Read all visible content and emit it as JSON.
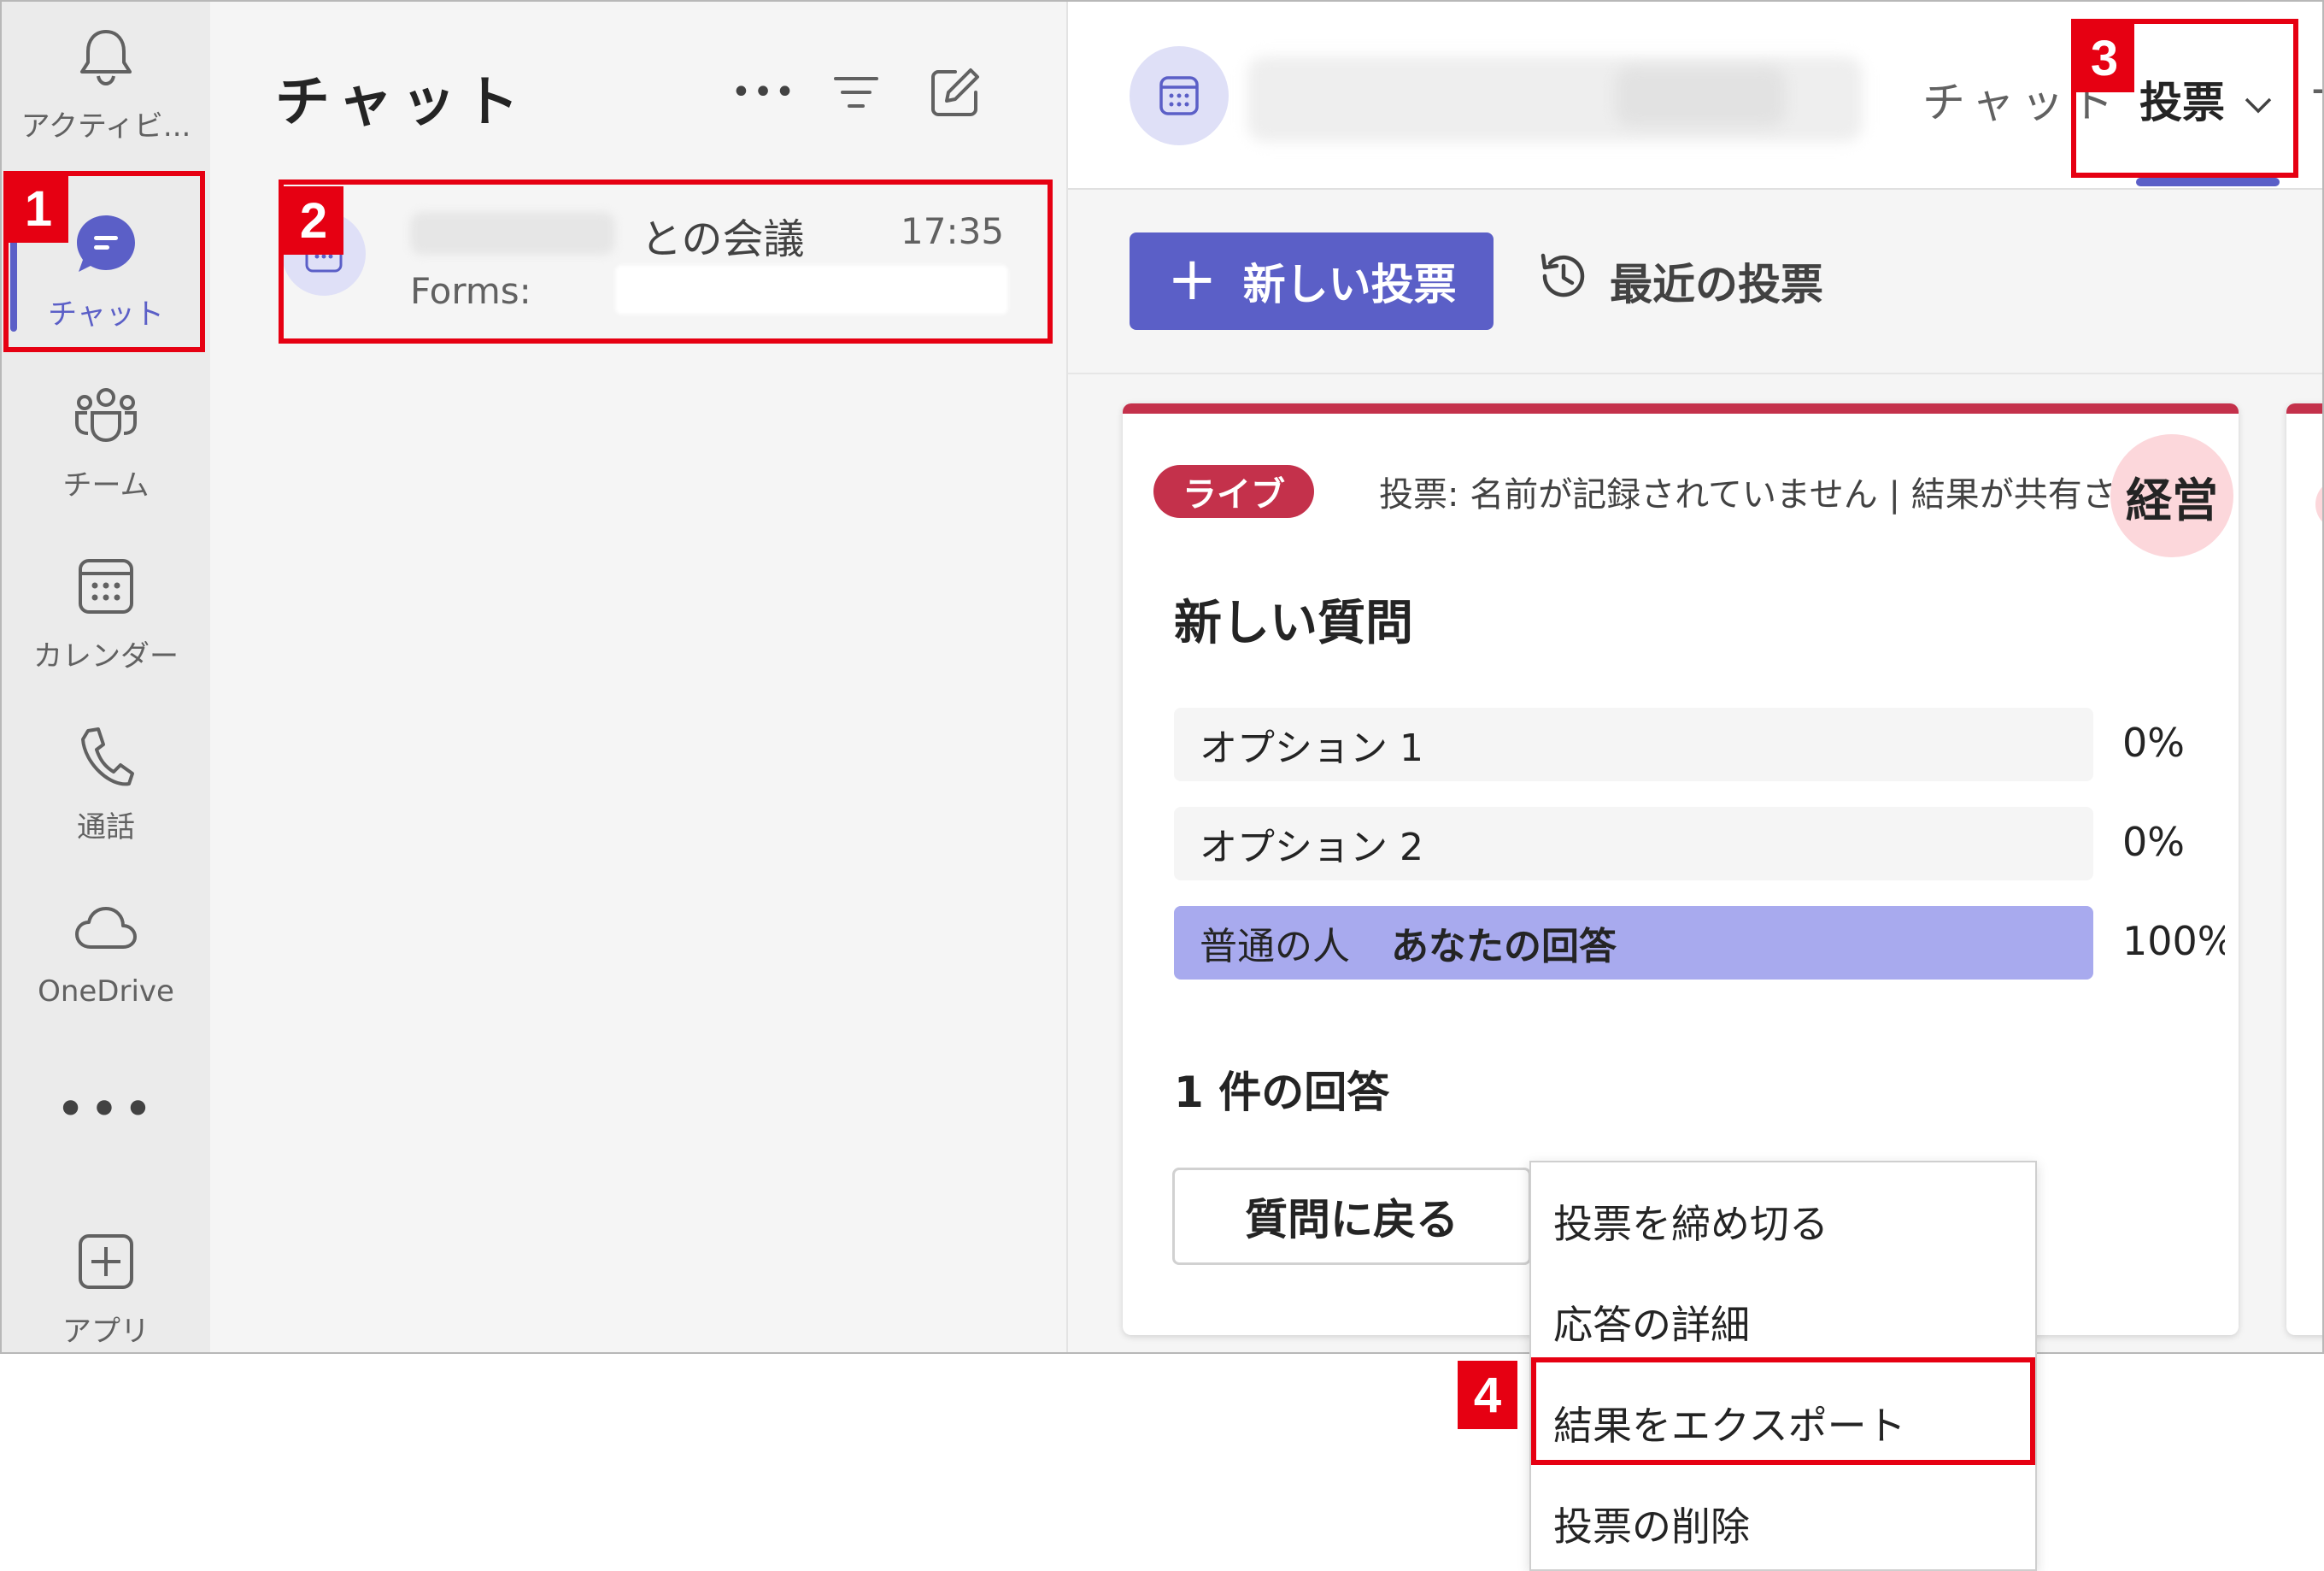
{
  "rail": {
    "items": [
      {
        "label": "アクティビ...",
        "icon": "bell-icon"
      },
      {
        "label": "チャット",
        "icon": "chat-icon"
      },
      {
        "label": "チーム",
        "icon": "teams-icon"
      },
      {
        "label": "カレンダー",
        "icon": "calendar-icon"
      },
      {
        "label": "通話",
        "icon": "phone-icon"
      },
      {
        "label": "OneDrive",
        "icon": "cloud-icon"
      },
      {
        "label": "アプリ",
        "icon": "add-app-icon"
      }
    ],
    "more_glyph": "•••"
  },
  "chatlist": {
    "title": "チャット",
    "more_glyph": "•••",
    "row": {
      "title": "との会議",
      "time": "17:35",
      "preview_prefix": "Forms:"
    }
  },
  "header": {
    "tabs": [
      {
        "label": "チャット"
      },
      {
        "label": "投票"
      }
    ],
    "plus_glyph": "+"
  },
  "toolbar": {
    "new_poll_label": "新しい投票",
    "plus_glyph": "+",
    "recent_label": "最近の投票"
  },
  "poll": {
    "status_badge": "ライブ",
    "meta": "投票: 名前が記録されていません | 結果が共有さ…",
    "avatar_text": "経営",
    "question": "新しい質問",
    "options": [
      {
        "label": "オプション 1",
        "mine_label": "",
        "percent": "0%",
        "fraction": 0
      },
      {
        "label": "オプション 2",
        "mine_label": "",
        "percent": "0%",
        "fraction": 0
      },
      {
        "label": "普通の人",
        "mine_label": "あなたの回答",
        "percent": "100%",
        "fraction": 1
      }
    ],
    "response_count": "1 件の回答",
    "back_label": "質問に戻る"
  },
  "menu": {
    "items": [
      {
        "label": "投票を締め切る"
      },
      {
        "label": "応答の詳細"
      },
      {
        "label": "結果をエクスポート"
      },
      {
        "label": "投票の削除"
      }
    ]
  },
  "annotations": {
    "numbers": [
      "1",
      "2",
      "3",
      "4"
    ],
    "color": "#e60012"
  },
  "colors": {
    "accent": "#5b5fc7",
    "live": "#c4314b",
    "vote_fill": "#a8aaee"
  }
}
